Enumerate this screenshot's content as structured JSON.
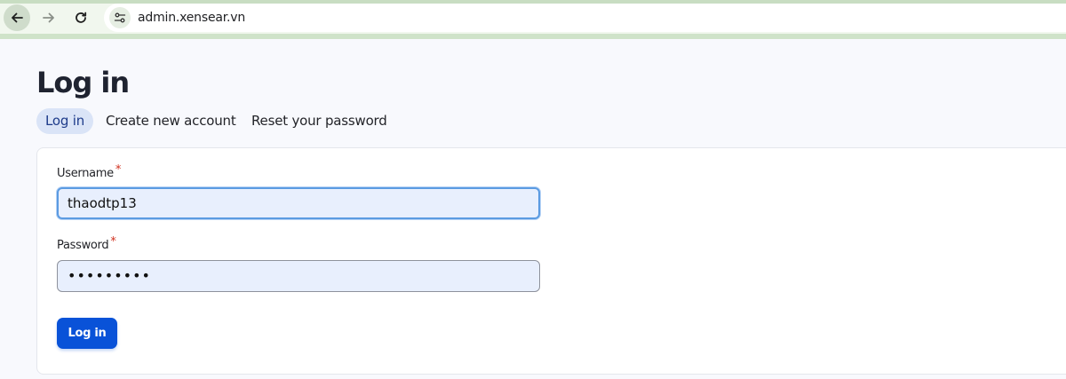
{
  "browser": {
    "url": "admin.xensear.vn",
    "back_icon": "arrow-left-icon",
    "forward_icon": "arrow-right-icon",
    "reload_icon": "reload-icon",
    "site_info_icon": "tune-icon"
  },
  "page": {
    "title": "Log in"
  },
  "tabs": [
    {
      "label": "Log in",
      "active": true
    },
    {
      "label": "Create new account",
      "active": false
    },
    {
      "label": "Reset your password",
      "active": false
    }
  ],
  "form": {
    "username": {
      "label": "Username",
      "required_mark": "*",
      "value": "thaodtp13"
    },
    "password": {
      "label": "Password",
      "required_mark": "*",
      "value": "•••••••••"
    },
    "submit_label": "Log in"
  },
  "colors": {
    "accent": "#0952d8",
    "tab_active_bg": "#dae4f7",
    "required": "#d0311f",
    "input_bg": "#e8effd",
    "chrome_bg": "#f1f7ee"
  }
}
